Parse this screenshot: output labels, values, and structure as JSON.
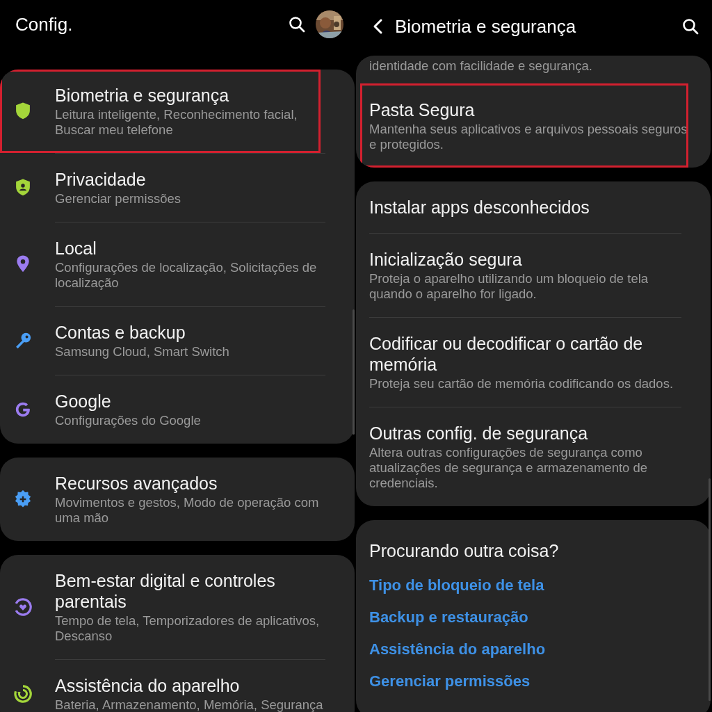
{
  "screens": [
    {
      "header": {
        "kind": "main",
        "title": "Config."
      },
      "groups": [
        {
          "kind": "list",
          "items": [
            {
              "title": "Biometria e segurança",
              "subtitle": "Leitura inteligente, Reconhecimento facial, Buscar meu telefone",
              "kind": "shield",
              "color": "#a4d63a",
              "highlighted": true
            },
            {
              "title": "Privacidade",
              "subtitle": "Gerenciar permissões",
              "kind": "shield-person",
              "color": "#a4d63a",
              "highlighted": false
            },
            {
              "title": "Local",
              "subtitle": "Configurações de localização, Solicitações de localização",
              "kind": "pin",
              "color": "#9b7cf0",
              "highlighted": false
            },
            {
              "title": "Contas e backup",
              "subtitle": "Samsung Cloud, Smart Switch",
              "kind": "key",
              "color": "#4a9ef5",
              "highlighted": false
            },
            {
              "title": "Google",
              "subtitle": "Configurações do Google",
              "kind": "g",
              "color": "#9b7cf0",
              "highlighted": false
            }
          ]
        },
        {
          "kind": "list",
          "items": [
            {
              "title": "Recursos avançados",
              "subtitle": "Movimentos e gestos, Modo de operação com uma mão",
              "kind": "gear-plus",
              "color": "#4a9ef5",
              "highlighted": false
            }
          ]
        },
        {
          "kind": "list",
          "items": [
            {
              "title": "Bem-estar digital e controles parentais",
              "subtitle": "Tempo de tela, Temporizadores de aplicativos, Descanso",
              "kind": "ring-heart",
              "color": "#9b7cf0",
              "highlighted": false
            },
            {
              "title": "Assistência do aparelho",
              "subtitle": "Bateria, Armazenamento, Memória, Segurança",
              "kind": "ring-refresh",
              "color": "#a4d63a",
              "highlighted": false
            }
          ]
        }
      ]
    },
    {
      "header": {
        "kind": "sub",
        "title": "Biometria e segurança"
      },
      "groups": [
        {
          "kind": "list",
          "items": [
            {
              "subtitle": "identidade com facilidade e segurança.",
              "highlighted": false
            },
            {
              "title": "Pasta Segura",
              "subtitle": "Mantenha seus aplicativos e arquivos pessoais seguros e protegidos.",
              "highlighted": true
            }
          ]
        },
        {
          "kind": "list",
          "items": [
            {
              "title": "Instalar apps desconhecidos",
              "highlighted": false
            },
            {
              "title": "Inicialização segura",
              "subtitle": "Proteja o aparelho utilizando um bloqueio de tela quando o aparelho for ligado.",
              "highlighted": false
            },
            {
              "title": "Codificar ou decodificar o cartão de memória",
              "subtitle": "Proteja seu cartão de memória codificando os dados.",
              "highlighted": false
            },
            {
              "title": "Outras config. de segurança",
              "subtitle": "Altera outras configurações de segurança como atualizações de segurança e armazenamento de credenciais.",
              "highlighted": false
            }
          ]
        },
        {
          "kind": "links",
          "heading": "Procurando outra coisa?",
          "links": [
            "Tipo de bloqueio de tela",
            "Backup e restauração",
            "Assistência do aparelho",
            "Gerenciar permissões"
          ]
        }
      ]
    }
  ]
}
